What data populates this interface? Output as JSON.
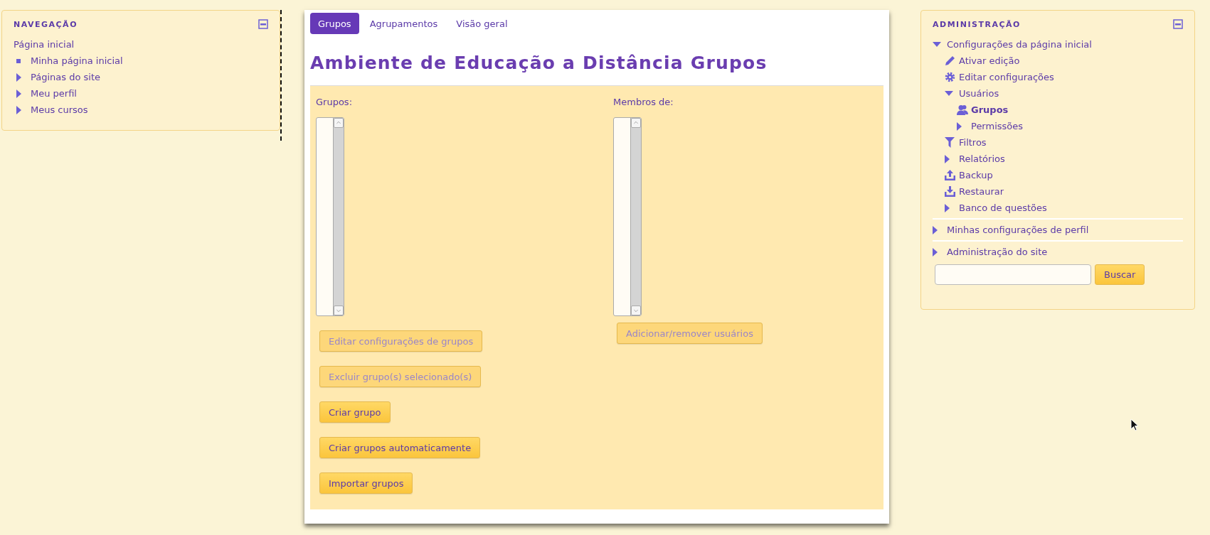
{
  "navigation": {
    "title": "NAVEGAÇÃO",
    "items": [
      {
        "label": "Página inicial",
        "kind": "root",
        "children": [
          {
            "label": "Minha página inicial",
            "kind": "leaf"
          },
          {
            "label": "Páginas do site",
            "kind": "branch",
            "expanded": false
          },
          {
            "label": "Meu perfil",
            "kind": "branch",
            "expanded": false
          },
          {
            "label": "Meus cursos",
            "kind": "branch",
            "expanded": false
          }
        ]
      }
    ]
  },
  "tabs": [
    {
      "label": "Grupos",
      "selected": true
    },
    {
      "label": "Agrupamentos",
      "selected": false
    },
    {
      "label": "Visão geral",
      "selected": false
    }
  ],
  "heading": "Ambiente de Educação a Distância Grupos",
  "groups_panel": {
    "label": "Grupos:",
    "buttons": [
      {
        "label": "Editar configurações de grupos",
        "disabled": true
      },
      {
        "label": "Excluir grupo(s) selecionado(s)",
        "disabled": true
      },
      {
        "label": "Criar grupo",
        "disabled": false
      },
      {
        "label": "Criar grupos automaticamente",
        "disabled": false
      },
      {
        "label": "Importar grupos",
        "disabled": false
      }
    ]
  },
  "members_panel": {
    "label": "Membros de:",
    "buttons": [
      {
        "label": "Adicionar/remover usuários",
        "disabled": true
      }
    ]
  },
  "administration": {
    "title": "ADMINISTRAÇÃO",
    "sections": [
      {
        "label": "Configurações da página inicial",
        "kind": "branch",
        "expanded": true,
        "children": [
          {
            "label": "Ativar edição",
            "kind": "pencil"
          },
          {
            "label": "Editar configurações",
            "kind": "gear"
          },
          {
            "label": "Usuários",
            "kind": "branch",
            "expanded": true,
            "children": [
              {
                "label": "Grupos",
                "kind": "users",
                "current": true
              },
              {
                "label": "Permissões",
                "kind": "branch",
                "expanded": false
              }
            ]
          },
          {
            "label": "Filtros",
            "kind": "filter"
          },
          {
            "label": "Relatórios",
            "kind": "branch",
            "expanded": false
          },
          {
            "label": "Backup",
            "kind": "upload"
          },
          {
            "label": "Restaurar",
            "kind": "download"
          },
          {
            "label": "Banco de questões",
            "kind": "branch",
            "expanded": false
          }
        ]
      },
      {
        "label": "Minhas configurações de perfil",
        "kind": "branch",
        "expanded": false
      },
      {
        "label": "Administração do site",
        "kind": "branch",
        "expanded": false
      }
    ],
    "search": {
      "button": "Buscar"
    }
  }
}
